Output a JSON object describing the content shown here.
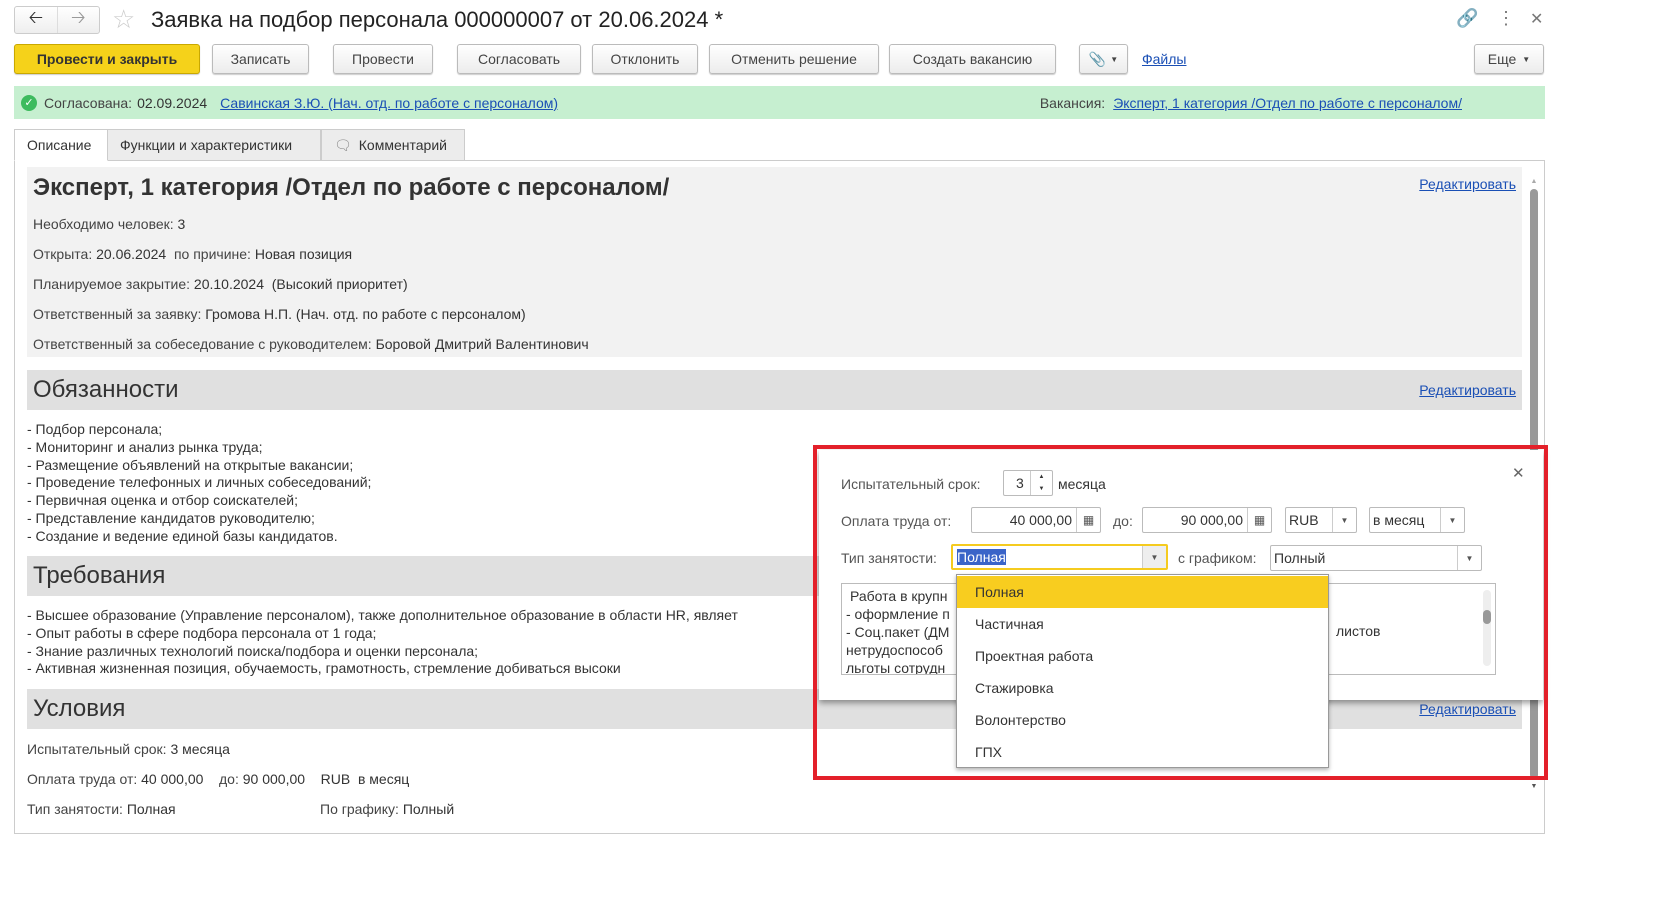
{
  "window": {
    "title": "Заявка на подбор персонала 000000007 от 20.06.2024 *"
  },
  "toolbar": {
    "post_close": "Провести и закрыть",
    "save": "Записать",
    "post": "Провести",
    "approve": "Согласовать",
    "reject": "Отклонить",
    "cancel_decision": "Отменить решение",
    "create_vacancy": "Создать вакансию",
    "files": "Файлы",
    "more": "Еще"
  },
  "status": {
    "label": "Согласована:",
    "date": "02.09.2024",
    "person": "Савинская З.Ю. (Нач. отд. по работе с персоналом)",
    "vacancy_label": "Вакансия:",
    "vacancy": "Эксперт, 1 категория /Отдел по работе с персоналом/",
    "color": "#c6efd0"
  },
  "tabs": [
    {
      "label": "Описание"
    },
    {
      "label": "Функции и характеристики"
    },
    {
      "label": "Комментарий"
    }
  ],
  "main": {
    "heading": "Эксперт, 1 категория /Отдел по работе с персоналом/",
    "edit": "Редактировать",
    "need_label": "Необходимо человек:",
    "need": "3",
    "opened_label": "Открыта:",
    "opened": "20.06.2024",
    "reason_label": "по причине:",
    "reason": "Новая позиция",
    "close_label": "Планируемое закрытие:",
    "close": "20.10.2024",
    "priority": "(Высокий приоритет)",
    "resp_label": "Ответственный за заявку:",
    "resp": "Громова Н.П. (Нач. отд. по работе с персоналом)",
    "interview_label": "Ответственный за собеседование с руководителем:",
    "interview": "Боровой Дмитрий Валентинович"
  },
  "duties": {
    "title": "Обязанности",
    "items": [
      "- Подбор персонала;",
      "- Мониторинг и анализ рынка труда;",
      "- Размещение объявлений на открытые вакансии;",
      "- Проведение телефонных и личных собеседований;",
      "- Первичная оценка и отбор соискателей;",
      "- Представление кандидатов руководителю;",
      "- Создание и ведение единой базы кандидатов."
    ]
  },
  "requirements": {
    "title": "Требования",
    "items": [
      "- Высшее образование (Управление персоналом), также дополнительное образование в области HR, являет",
      "- Опыт работы в сфере подбора персонала от 1 года;",
      "- Знание различных технологий поиска/подбора и оценки персонала;",
      "- Активная жизненная позиция, обучаемость, грамотность, стремление добиваться высоки"
    ]
  },
  "conditions": {
    "title": "Условия",
    "probation_label": "Испытательный срок:",
    "probation": "3 месяца",
    "pay_from_label": "Оплата труда от:",
    "pay_from": "40 000,00",
    "pay_to_label": "до:",
    "pay_to": "90 000,00",
    "currency": "RUB",
    "period": "в месяц",
    "type_label": "Тип занятости:",
    "type": "Полная",
    "schedule_label": "По графику:",
    "schedule": "Полный"
  },
  "popup": {
    "probation_label": "Испытательный срок:",
    "probation": "3",
    "months": "месяца",
    "pay_from_label": "Оплата труда от:",
    "pay_from": "40 000,00",
    "pay_to_label": "до:",
    "pay_to": "90 000,00",
    "currency": "RUB",
    "period": "в месяц",
    "type_label": "Тип занятости:",
    "type": "Полная",
    "schedule_label": "с графиком:",
    "schedule": "Полный",
    "text_lines": [
      "Работа в крупн",
      "- оформление п",
      "- Соц.пакет (ДМ",
      "нетрудоспособ",
      "льготы сотрудн"
    ],
    "text_right": "листов",
    "options": [
      "Полная",
      "Частичная",
      "Проектная работа",
      "Стажировка",
      "Волонтерство",
      "ГПХ"
    ],
    "highlight_color": "#f8cd1f",
    "frame_color": "#e3202a"
  }
}
